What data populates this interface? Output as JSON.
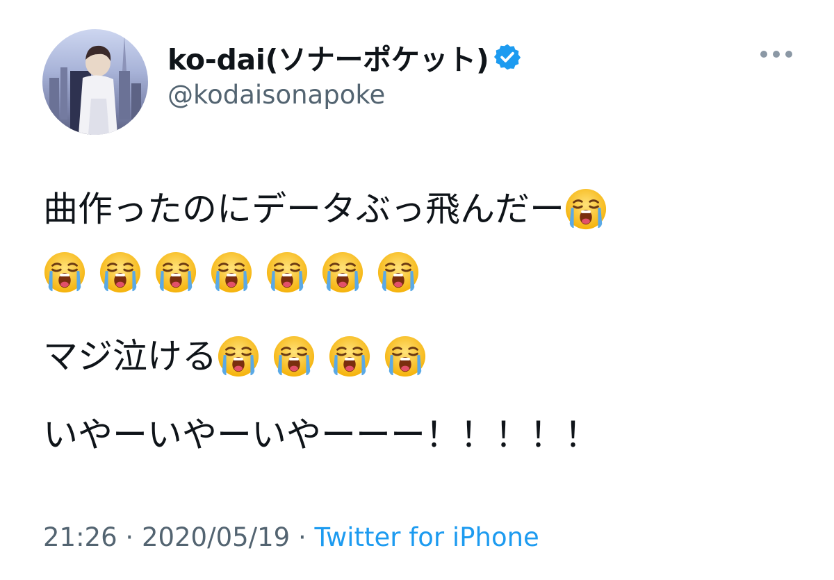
{
  "author": {
    "display_name": "ko-dai(ソナーポケット)",
    "handle": "@kodaisonapoke",
    "verified": true,
    "avatar_icon": "profile-photo-icon"
  },
  "tweet": {
    "line1_text": "曲作ったのにデータぶっ飛んだー",
    "line1_emoji_count": 1,
    "line2_emoji_count": 7,
    "line3_text": "マジ泣ける",
    "line3_emoji_count": 4,
    "line4_text": "いやーいやーいやーーー！！！！！",
    "emoji_icon": "loudly-crying-face-icon"
  },
  "meta": {
    "time": "21:26",
    "separator": "·",
    "date": "2020/05/19",
    "source": "Twitter for iPhone"
  },
  "colors": {
    "text": "#0f1419",
    "secondary": "#536471",
    "accent": "#1d9bf0"
  },
  "more_icon": "more-horizontal-icon"
}
